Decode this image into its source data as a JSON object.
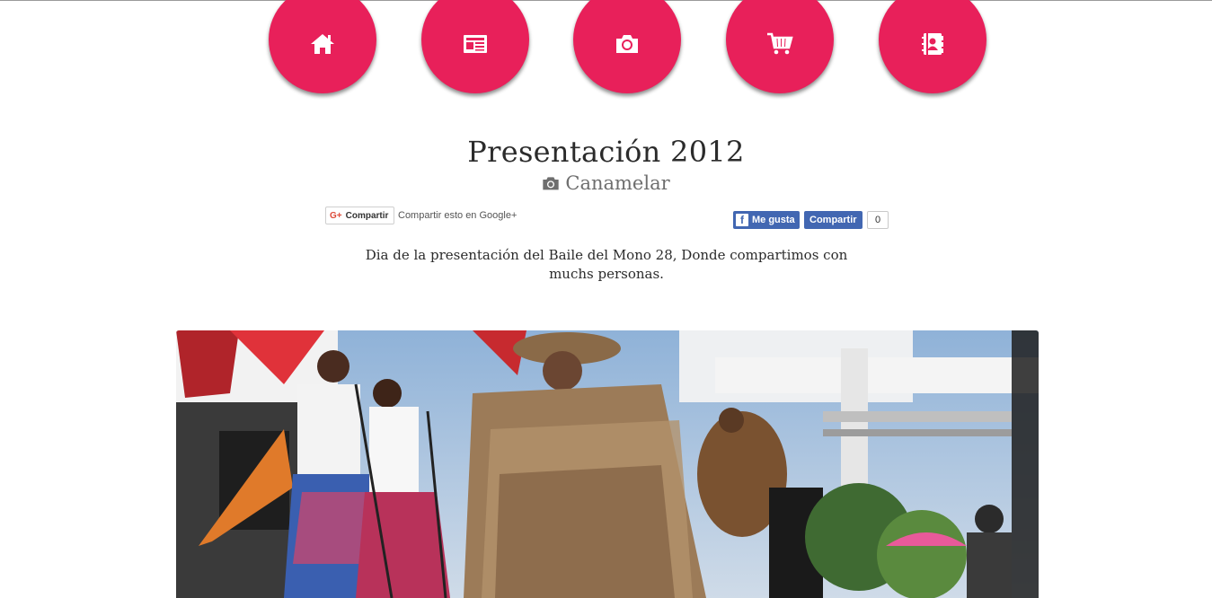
{
  "nav": {
    "items": [
      {
        "icon": "home-icon"
      },
      {
        "icon": "newspaper-icon"
      },
      {
        "icon": "camera-icon"
      },
      {
        "icon": "shopping-cart-icon"
      },
      {
        "icon": "contacts-book-icon"
      }
    ],
    "color": "#e8205a"
  },
  "post": {
    "title": "Presentación 2012",
    "category": "Canamelar",
    "category_icon": "camera-icon",
    "description": "Dia de la presentación del Baile del Mono 28, Donde compartimos con muchs personas."
  },
  "share": {
    "gplus_label": "Compartir",
    "gplus_text": "Compartir esto en Google+",
    "fb_like_label": "Me gusta",
    "fb_share_label": "Compartir",
    "fb_count": "0"
  },
  "photo": {
    "alt_description_icon": "photo-image"
  }
}
